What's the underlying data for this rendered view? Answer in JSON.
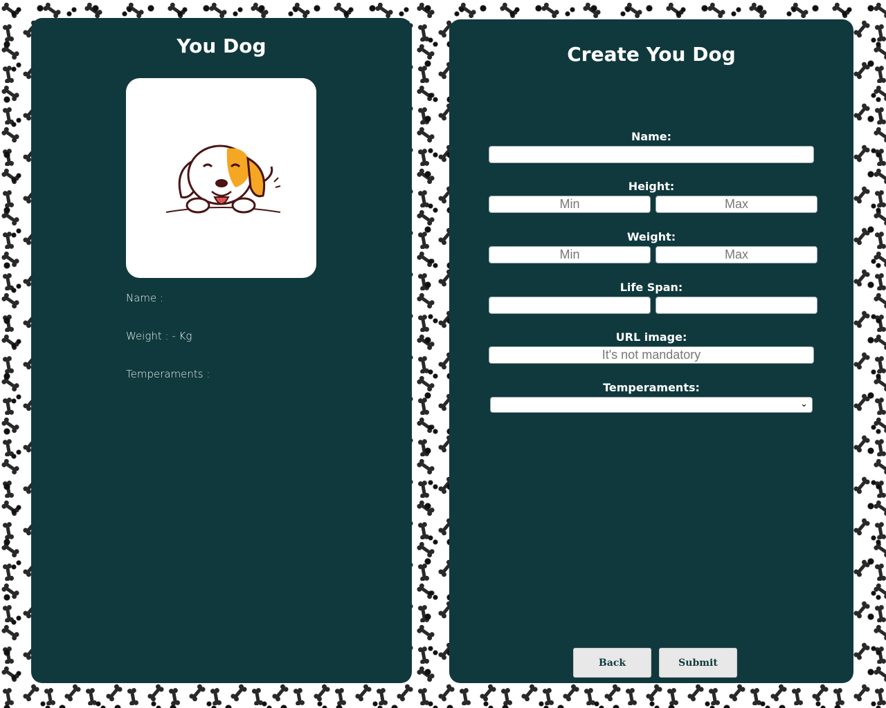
{
  "preview": {
    "title": "You Dog",
    "name_line": "Name :",
    "weight_line": "Weight : - Kg",
    "temperaments_line": "Temperaments :"
  },
  "form": {
    "title": "Create You Dog",
    "name": {
      "label": "Name:",
      "value": ""
    },
    "height": {
      "label": "Height:",
      "min_placeholder": "Min",
      "max_placeholder": "Max"
    },
    "weight": {
      "label": "Weight:",
      "min_placeholder": "Min",
      "max_placeholder": "Max"
    },
    "life_span": {
      "label": "Life Span:"
    },
    "url_image": {
      "label": "URL image:",
      "placeholder": "It's not mandatory"
    },
    "temperaments": {
      "label": "Temperaments:",
      "selected": ""
    },
    "back_label": "Back",
    "submit_label": "Submit"
  },
  "background_pattern": {
    "icon": "bone-and-paw-pattern"
  },
  "colors": {
    "panel": "#10393d",
    "ear_accent": "#f5a623"
  }
}
